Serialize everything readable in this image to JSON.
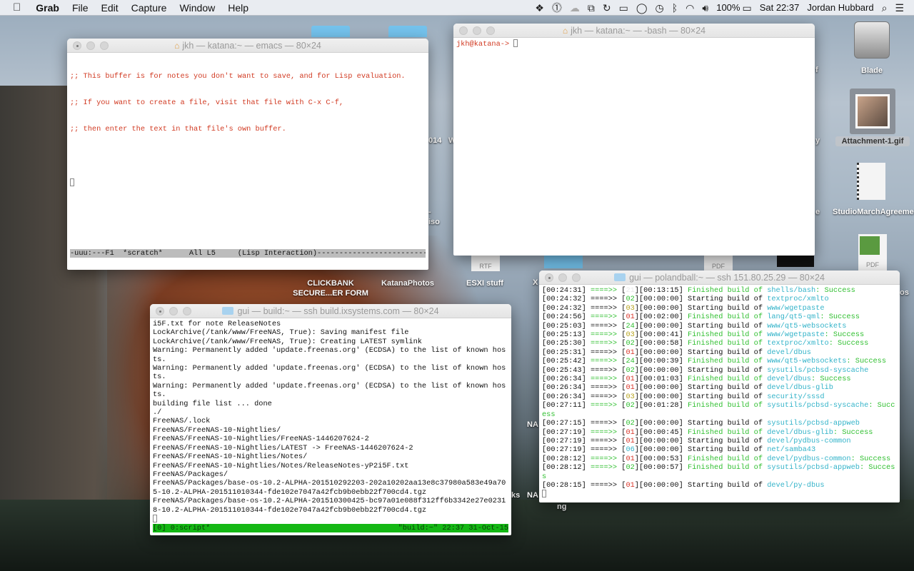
{
  "menubar": {
    "app": "Grab",
    "items": [
      "File",
      "Edit",
      "Capture",
      "Window",
      "Help"
    ],
    "battery": "100%",
    "clock": "Sat 22:37",
    "user": "Jordan Hubbard",
    "status_icons": [
      "dropbox-icon",
      "onepassword-icon",
      "cloud-icon",
      "screen-share-icon",
      "lock-sync-icon",
      "airplay-icon",
      "messages-icon",
      "time-machine-icon",
      "bluetooth-icon",
      "wifi-icon",
      "volume-icon",
      "battery-icon",
      "spotlight-icon",
      "notification-center-icon"
    ]
  },
  "desktop": {
    "icons": [
      {
        "label": "Blade"
      },
      {
        "label": "Attachment-1.gif"
      },
      {
        "label": "StudioMarchAgreement"
      },
      {
        "label": "PDF"
      },
      {
        "label": "CLICKBANK SECURE...ER FORM"
      },
      {
        "label": "KatanaPhotos"
      },
      {
        "label": "ESXI stuff"
      },
      {
        "label": "RTF"
      },
      {
        "label": "PDF"
      }
    ],
    "fragments": [
      "014",
      "W",
      "iso",
      "-",
      "f",
      "y",
      "e",
      "X",
      "NA",
      "NA",
      "ks",
      "ng",
      "os"
    ]
  },
  "emacs": {
    "title": "jkh — katana:~ — emacs — 80×24",
    "lines": [
      ";; This buffer is for notes you don't want to save, and for Lisp evaluation.",
      ";; If you want to create a file, visit that file with C-x C-f,",
      ";; then enter the text in that file's own buffer."
    ],
    "modeline": "-uuu:---F1  *scratch*      All L5     (Lisp Interaction)------------------------------------"
  },
  "bash": {
    "title": "jkh — katana:~ — -bash — 80×24",
    "prompt": "jkh@katana-> "
  },
  "build": {
    "title": "gui — build:~ — ssh build.ixsystems.com — 80×24",
    "lines": [
      "i5F.txt for note ReleaseNotes",
      "LockArchive(/tank/www/FreeNAS, True): Saving manifest file",
      "LockArchive(/tank/www/FreeNAS, True): Creating LATEST symlink",
      "Warning: Permanently added 'update.freenas.org' (ECDSA) to the list of known hosts.",
      "Warning: Permanently added 'update.freenas.org' (ECDSA) to the list of known hosts.",
      "Warning: Permanently added 'update.freenas.org' (ECDSA) to the list of known hosts.",
      "building file list ... done",
      "./",
      "FreeNAS/.lock",
      "FreeNAS/FreeNAS-10-Nightlies/",
      "FreeNAS/FreeNAS-10-Nightlies/FreeNAS-1446207624-2",
      "FreeNAS/FreeNAS-10-Nightlies/LATEST -> FreeNAS-1446207624-2",
      "FreeNAS/FreeNAS-10-Nightlies/Notes/",
      "FreeNAS/FreeNAS-10-Nightlies/Notes/ReleaseNotes-yP2i5F.txt",
      "FreeNAS/Packages/",
      "FreeNAS/Packages/base-os-10.2-ALPHA-201510292203-202a10202aa13e8c37980a583e49a705-10.2-ALPHA-201511010344-fde102e7047a42fcb9b0ebb22f700cd4.tgz",
      "FreeNAS/Packages/base-os-10.2-ALPHA-201510300425-bc97a01e088f312ff6b3342e27e02318-10.2-ALPHA-201511010344-fde102e7047a42fcb9b0ebb22f700cd4.tgz"
    ],
    "status_left": "[0] 0:script*",
    "status_right": "\"build:~\" 22:37 31-Oct-15"
  },
  "poudriere": {
    "title": "gui — polandball:~ — ssh 151.80.25.29 — 80×24",
    "arrow": "====>>",
    "starting": "Starting build of",
    "finished": "Finished build of",
    "success": ": Success",
    "id_colors": {
      "21": "#e8e8e8",
      "02": "#2fbf2f",
      "03": "#b8a420",
      "01": "#d8362a",
      "24": "#2fbf2f",
      "06": "#33b3c9"
    },
    "rows": [
      {
        "time": "00:24:31",
        "id": "21",
        "elapsed": "00:13:15",
        "done": true,
        "port": "shells/bash"
      },
      {
        "time": "00:24:32",
        "id": "02",
        "elapsed": "00:00:00",
        "done": false,
        "port": "textproc/xmlto"
      },
      {
        "time": "00:24:32",
        "id": "03",
        "elapsed": "00:00:00",
        "done": false,
        "port": "www/wgetpaste"
      },
      {
        "time": "00:24:56",
        "id": "01",
        "elapsed": "00:02:00",
        "done": true,
        "port": "lang/qt5-qml"
      },
      {
        "time": "00:25:03",
        "id": "24",
        "elapsed": "00:00:00",
        "done": false,
        "port": "www/qt5-websockets"
      },
      {
        "time": "00:25:13",
        "id": "03",
        "elapsed": "00:00:41",
        "done": true,
        "port": "www/wgetpaste"
      },
      {
        "time": "00:25:30",
        "id": "02",
        "elapsed": "00:00:58",
        "done": true,
        "port": "textproc/xmlto"
      },
      {
        "time": "00:25:31",
        "id": "01",
        "elapsed": "00:00:00",
        "done": false,
        "port": "devel/dbus"
      },
      {
        "time": "00:25:42",
        "id": "24",
        "elapsed": "00:00:39",
        "done": true,
        "port": "www/qt5-websockets"
      },
      {
        "time": "00:25:43",
        "id": "02",
        "elapsed": "00:00:00",
        "done": false,
        "port": "sysutils/pcbsd-syscache"
      },
      {
        "time": "00:26:34",
        "id": "01",
        "elapsed": "00:01:03",
        "done": true,
        "port": "devel/dbus"
      },
      {
        "time": "00:26:34",
        "id": "01",
        "elapsed": "00:00:00",
        "done": false,
        "port": "devel/dbus-glib"
      },
      {
        "time": "00:26:34",
        "id": "03",
        "elapsed": "00:00:00",
        "done": false,
        "port": "security/sssd"
      },
      {
        "time": "00:27:11",
        "id": "02",
        "elapsed": "00:01:28",
        "done": true,
        "port": "sysutils/pcbsd-syscache"
      },
      {
        "time": "00:27:15",
        "id": "02",
        "elapsed": "00:00:00",
        "done": false,
        "port": "sysutils/pcbsd-appweb"
      },
      {
        "time": "00:27:19",
        "id": "01",
        "elapsed": "00:00:45",
        "done": true,
        "port": "devel/dbus-glib"
      },
      {
        "time": "00:27:19",
        "id": "01",
        "elapsed": "00:00:00",
        "done": false,
        "port": "devel/pydbus-common"
      },
      {
        "time": "00:27:19",
        "id": "06",
        "elapsed": "00:00:00",
        "done": false,
        "port": "net/samba43"
      },
      {
        "time": "00:28:12",
        "id": "01",
        "elapsed": "00:00:53",
        "done": true,
        "port": "devel/pydbus-common"
      },
      {
        "time": "00:28:12",
        "id": "02",
        "elapsed": "00:00:57",
        "done": true,
        "port": "sysutils/pcbsd-appweb"
      },
      {
        "time": "00:28:15",
        "id": "01",
        "elapsed": "00:00:00",
        "done": false,
        "port": "devel/py-dbus"
      }
    ]
  }
}
